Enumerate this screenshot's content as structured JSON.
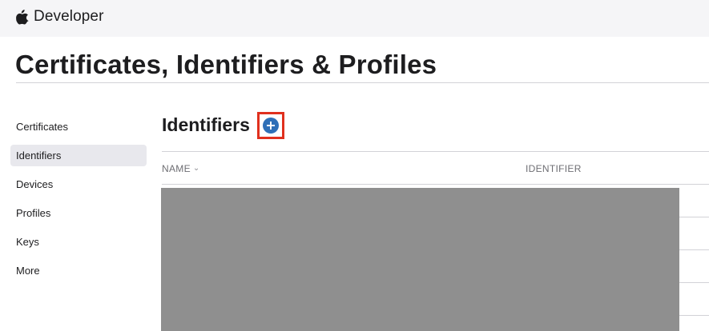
{
  "header": {
    "brand_text": "Developer",
    "logo_icon": "apple-logo-icon"
  },
  "page": {
    "title": "Certificates, Identifiers & Profiles"
  },
  "sidebar": {
    "items": [
      {
        "label": "Certificates",
        "active": false
      },
      {
        "label": "Identifiers",
        "active": true
      },
      {
        "label": "Devices",
        "active": false
      },
      {
        "label": "Profiles",
        "active": false
      },
      {
        "label": "Keys",
        "active": false
      },
      {
        "label": "More",
        "active": false
      }
    ]
  },
  "main": {
    "section_title": "Identifiers",
    "add_icon": "plus-circle-icon",
    "table": {
      "columns": [
        {
          "label": "NAME",
          "sort_icon": "chevron-down-icon"
        },
        {
          "label": "IDENTIFIER"
        }
      ],
      "rows_redacted": true
    }
  },
  "colors": {
    "accent": "#2e6fb7",
    "highlight": "#e0301e",
    "redaction": "#8f8f8f"
  }
}
